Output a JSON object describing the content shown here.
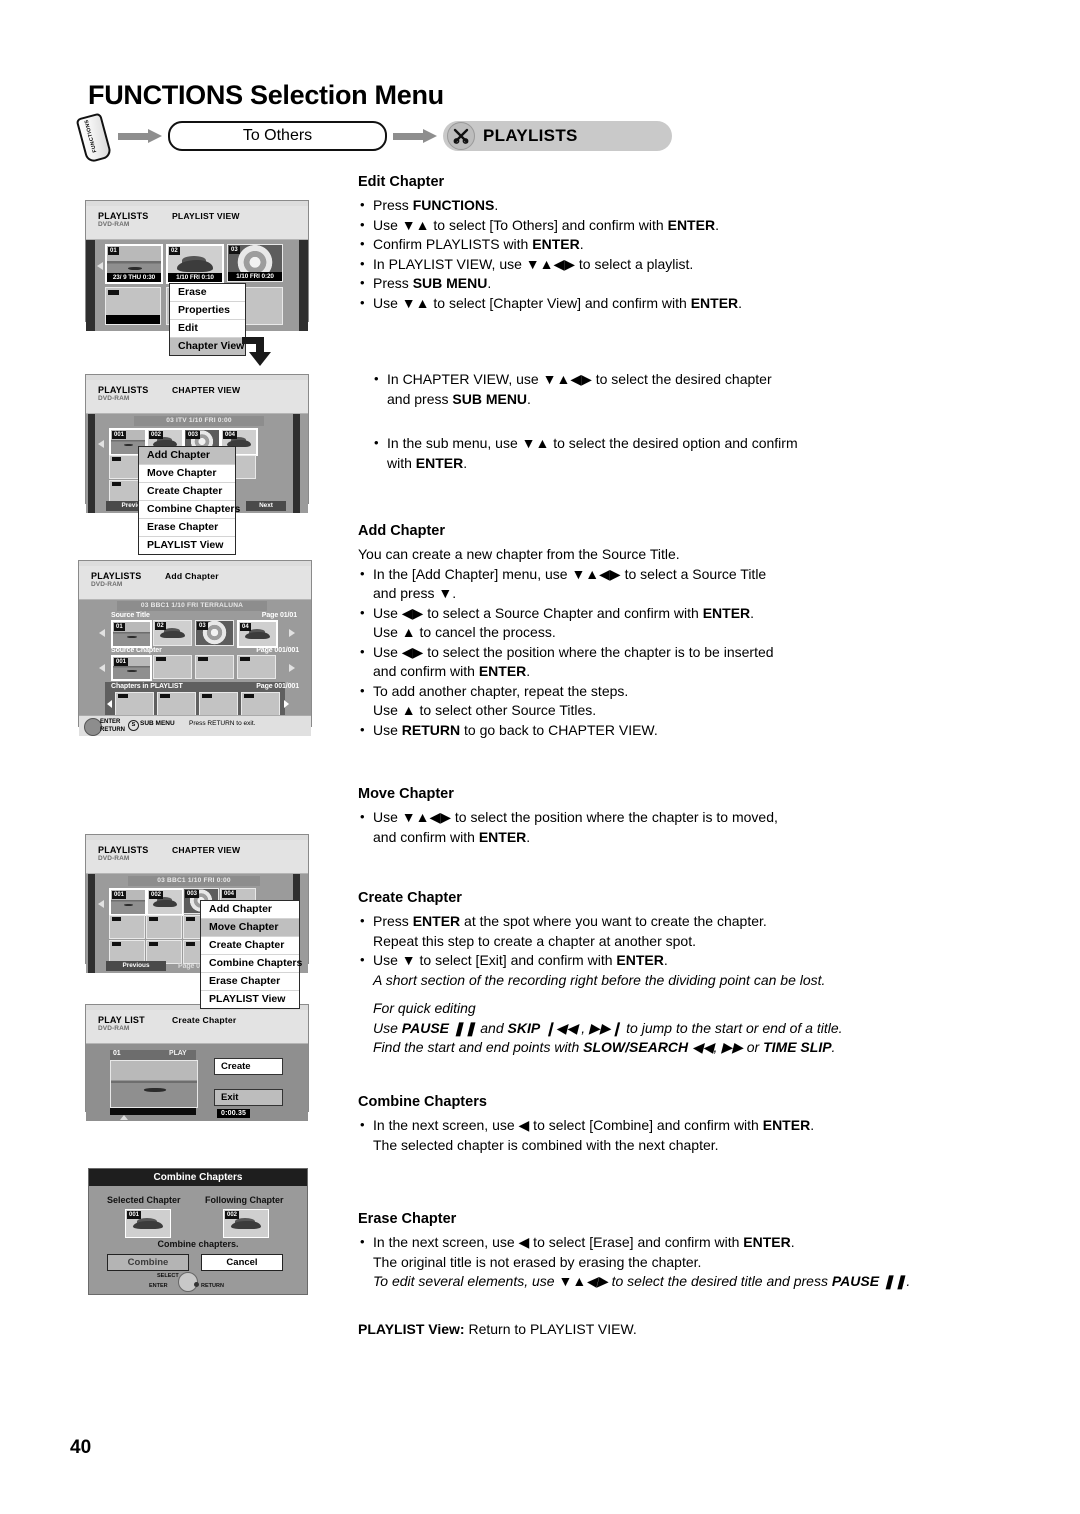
{
  "page": {
    "title": "FUNCTIONS Selection Menu",
    "number": "40"
  },
  "flow": {
    "remote_button_label": "FUNCTIONS",
    "step1_label": "To Others",
    "step2_label": "PLAYLISTS",
    "step2_icon": "scissors-icon",
    "arrow_color": "#8e8e8e",
    "pill_gray": "#c9c9c9"
  },
  "sections": {
    "edit_chapter": {
      "heading": "Edit Chapter",
      "bullets": [
        "Press <b>FUNCTIONS</b>.",
        "Use ▼▲ to select [To Others] and confirm with <b>ENTER</b>.",
        "Confirm PLAYLISTS with <b>ENTER</b>.",
        "In PLAYLIST VIEW, use ▼▲◀▶ to select a playlist.",
        "Press <b>SUB MENU</b>.",
        "Use ▼▲ to select [Chapter View] and confirm with <b>ENTER</b>."
      ]
    },
    "chapter_view_steps": {
      "bullets": [
        "In CHAPTER VIEW, use ▼▲◀▶ to select the desired chapter<br>and press <b>SUB MENU</b>.",
        "In the sub menu, use ▼▲ to select the desired option and confirm<br>with <b>ENTER</b>."
      ]
    },
    "add_chapter": {
      "heading": "Add Chapter",
      "intro": "You can create a new chapter from the Source Title.",
      "bullets": [
        "In the [Add Chapter] menu, use ▼▲◀▶ to select a Source Title<br>and press ▼.",
        "Use ◀▶ to select a Source Chapter and confirm with <b>ENTER</b>.<br>Use ▲ to cancel the process.",
        "Use ◀▶ to select the position where the chapter is to be inserted<br>and confirm with <b>ENTER</b>.",
        "To add another chapter, repeat the steps.<br>Use ▲ to select other Source Titles.",
        "Use <b>RETURN</b> to go back to CHAPTER VIEW."
      ]
    },
    "move_chapter": {
      "heading": "Move Chapter",
      "bullets": [
        "Use ▼▲◀▶ to select the position where the chapter is to moved,<br>and confirm with <b>ENTER</b>."
      ]
    },
    "create_chapter": {
      "heading": "Create Chapter",
      "bullets": [
        "Press <b>ENTER</b> at the spot where you want to create the chapter.<br>Repeat this step to create a chapter at another spot.",
        "Use ▼ to select [Exit] and confirm with <b>ENTER</b>."
      ],
      "note": "A short section of the recording right before the dividing point can be lost.",
      "quick_heading": "For quick editing",
      "quick_lines": [
        "Use <b>PAUSE</b> ❚❚ and <b>SKIP</b> ❙◀◀ , ▶▶❙ to jump to the start or end of a title.",
        "Find the start and end points with <b>SLOW/SEARCH</b> ◀◀, ▶▶ or <b>TIME SLIP</b>."
      ]
    },
    "combine_chapters": {
      "heading": "Combine Chapters",
      "bullets": [
        "In the next screen, use ◀ to select [Combine] and confirm with <b>ENTER</b>.<br>The selected chapter is combined with the next chapter."
      ]
    },
    "erase_chapter": {
      "heading": "Erase Chapter",
      "bullets": [
        "In the next screen, use ◀ to select [Erase] and confirm with <b>ENTER</b>.<br>The original title is not erased by erasing the chapter."
      ],
      "note": "To edit several elements, use ▼▲◀▶ to select the desired title and press <b>PAUSE</b> ❚❚."
    },
    "playlist_view_note": "<b>PLAYLIST View:</b> Return to PLAYLIST VIEW."
  },
  "screens": {
    "playlist_view": {
      "brand": "PLAYLISTS",
      "disc": "DVD-RAM",
      "mode": "PLAYLIST VIEW",
      "thumbs": [
        {
          "num": "01",
          "caption": "23/ 9 THU  0:30",
          "art": "sc-lake"
        },
        {
          "num": "02",
          "caption": "1/10  FRI  0:10",
          "art": "sc-car"
        },
        {
          "num": "03",
          "caption": "1/10  FRI  0:20",
          "art": "sc-flower"
        }
      ],
      "menu": [
        {
          "label": "Erase",
          "selected": false
        },
        {
          "label": "Properties",
          "selected": false
        },
        {
          "label": "Edit",
          "selected": false
        },
        {
          "label": "Chapter View",
          "selected": true
        }
      ]
    },
    "chapter_view_1": {
      "brand": "PLAYLISTS",
      "disc": "DVD-RAM",
      "mode": "CHAPTER VIEW",
      "header_band": "03   ITV    1/10  FRI   0:00",
      "thumbs": [
        {
          "num": "001",
          "art": "sc-lake"
        },
        {
          "num": "002",
          "art": "sc-car"
        },
        {
          "num": "003",
          "art": "sc-flower"
        },
        {
          "num": "004",
          "art": "sc-car"
        }
      ],
      "prev_label": "Previous",
      "next_label": "Next",
      "menu": [
        {
          "label": "Add Chapter",
          "selected": true
        },
        {
          "label": "Move Chapter",
          "selected": false
        },
        {
          "label": "Create Chapter",
          "selected": false
        },
        {
          "label": "Combine Chapters",
          "selected": false
        },
        {
          "label": "Erase Chapter",
          "selected": false
        },
        {
          "label": "PLAYLIST View",
          "selected": false
        }
      ]
    },
    "add_chapter": {
      "brand": "PLAYLISTS",
      "disc": "DVD-RAM",
      "mode": "Add Chapter",
      "header_band": "03   BBC1  1/10  FRI    TERRALUNA",
      "row1_label": "Source Title",
      "row1_page": "Page  01/01",
      "row2_label": "Source Chapter",
      "row2_page": "Page  001/001",
      "row3_label": "Chapters in PLAYLIST",
      "row3_page": "Page  001/001",
      "title_thumbs": [
        {
          "num": "01",
          "art": "sc-lake"
        },
        {
          "num": "02",
          "art": "sc-car"
        },
        {
          "num": "03",
          "art": "sc-flower"
        },
        {
          "num": "04",
          "art": "sc-car"
        }
      ],
      "chapter_thumbs": [
        {
          "num": "001",
          "art": "sc-lake"
        },
        {
          "num": "",
          "art": "sc-gray"
        },
        {
          "num": "",
          "art": "sc-gray"
        },
        {
          "num": "",
          "art": "sc-gray"
        }
      ],
      "footer_enter": "ENTER",
      "footer_return": "RETURN",
      "footer_submenu": "SUB MENU",
      "footer_hint": "Press RETURN to exit."
    },
    "chapter_view_2": {
      "brand": "PLAYLISTS",
      "disc": "DVD-RAM",
      "mode": "CHAPTER VIEW",
      "header_band": "03   BBC1   1/10  FRI  0:00",
      "thumbs": [
        {
          "num": "001",
          "art": "sc-lake"
        },
        {
          "num": "002",
          "art": "sc-car"
        },
        {
          "num": "003",
          "art": "sc-flower"
        },
        {
          "num": "004",
          "art": "sc-gray"
        }
      ],
      "prev_label": "Previous",
      "page_label": "Page   01/01",
      "menu": [
        {
          "label": "Add Chapter",
          "selected": false
        },
        {
          "label": "Move Chapter",
          "selected": true
        },
        {
          "label": "Create Chapter",
          "selected": false
        },
        {
          "label": "Combine Chapters",
          "selected": false
        },
        {
          "label": "Erase Chapter",
          "selected": false
        },
        {
          "label": "PLAYLIST View",
          "selected": false
        }
      ]
    },
    "create_chapter": {
      "brand": "PLAY LIST",
      "disc": "DVD-RAM",
      "mode": "Create Chapter",
      "thumb_num": "01",
      "play_tag": "PLAY",
      "create_label": "Create",
      "exit_label": "Exit",
      "time": "0:00.35"
    },
    "combine_dialog": {
      "title": "Combine Chapters",
      "left_label": "Selected Chapter",
      "right_label": "Following Chapter",
      "left_num": "001",
      "right_num": "002",
      "message": "Combine chapters.",
      "combine_label": "Combine",
      "cancel_label": "Cancel",
      "hint_select": "SELECT",
      "hint_enter": "ENTER",
      "hint_return": "RETURN"
    }
  }
}
